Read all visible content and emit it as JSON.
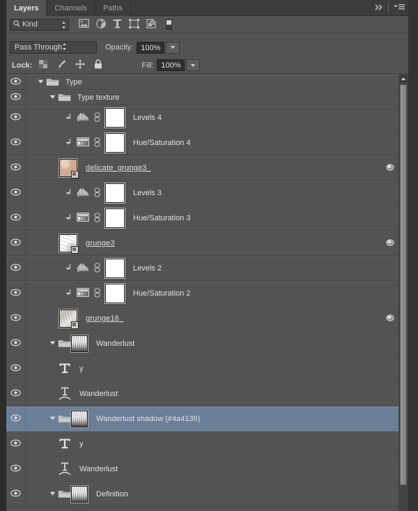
{
  "panel": {
    "tabs": [
      {
        "label": "Layers",
        "active": true
      },
      {
        "label": "Channels",
        "active": false
      },
      {
        "label": "Paths",
        "active": false
      }
    ],
    "collapse_icon": "double-chevron-right-icon",
    "menu_icon": "panel-menu-icon"
  },
  "filter": {
    "kind_label": "Kind",
    "search_icon": "search-icon",
    "icons": [
      "pixel-layer-filter-icon",
      "adjustment-layer-filter-icon",
      "type-layer-filter-icon",
      "shape-layer-filter-icon",
      "smart-object-filter-icon",
      "filter-toggle-switch"
    ]
  },
  "blend": {
    "mode": "Pass Through",
    "opacity_label": "Opacity:",
    "opacity_value": "100%"
  },
  "lock": {
    "label": "Lock:",
    "icons": [
      "lock-transparent-pixels-icon",
      "lock-image-pixels-icon",
      "lock-position-icon",
      "lock-all-icon"
    ],
    "fill_label": "Fill:",
    "fill_value": "100%"
  },
  "layers": [
    {
      "name": "Type",
      "type": "group",
      "indent": 1,
      "expanded": true,
      "visible": true,
      "selected": false
    },
    {
      "name": "Type texture",
      "type": "group",
      "indent": 2,
      "expanded": true,
      "visible": true,
      "selected": false
    },
    {
      "name": "Levels 4",
      "type": "adjustment",
      "adj_icon": "levels-icon",
      "clipped": true,
      "linked": true,
      "indent": 3,
      "visible": true,
      "selected": false
    },
    {
      "name": "Hue/Saturation 4",
      "type": "adjustment",
      "adj_icon": "hue-saturation-icon",
      "clipped": true,
      "linked": true,
      "indent": 3,
      "visible": true,
      "selected": false
    },
    {
      "name": "delicate_grunge3_",
      "type": "smartobject",
      "indent": 3,
      "visible": true,
      "selected": false,
      "has_fx": true,
      "thumb": "texture-beige"
    },
    {
      "name": "Levels 3",
      "type": "adjustment",
      "adj_icon": "levels-icon",
      "clipped": true,
      "linked": true,
      "indent": 3,
      "visible": true,
      "selected": false
    },
    {
      "name": "Hue/Saturation 3",
      "type": "adjustment",
      "adj_icon": "hue-saturation-icon",
      "clipped": true,
      "linked": true,
      "indent": 3,
      "visible": true,
      "selected": false
    },
    {
      "name": "grunge3",
      "type": "smartobject",
      "indent": 3,
      "visible": true,
      "selected": false,
      "has_fx": true,
      "thumb": "texture-light"
    },
    {
      "name": "Levels 2",
      "type": "adjustment",
      "adj_icon": "levels-icon",
      "clipped": true,
      "linked": true,
      "indent": 3,
      "visible": true,
      "selected": false
    },
    {
      "name": "Hue/Saturation 2",
      "type": "adjustment",
      "adj_icon": "hue-saturation-icon",
      "clipped": true,
      "linked": true,
      "indent": 3,
      "visible": true,
      "selected": false
    },
    {
      "name": "grunge16_",
      "type": "smartobject",
      "indent": 3,
      "visible": true,
      "selected": false,
      "has_fx": true,
      "thumb": "texture-grey"
    },
    {
      "name": "Wanderlust",
      "type": "group-thumb",
      "indent": 2,
      "expanded": true,
      "visible": true,
      "selected": false,
      "thumb": "texture-dark"
    },
    {
      "name": "y",
      "type": "type",
      "indent": 3,
      "visible": true,
      "selected": false
    },
    {
      "name": "Wanderlust",
      "type": "warped-type",
      "indent": 3,
      "visible": true,
      "selected": false
    },
    {
      "name": "Wanderlust shadow (#4a4136)",
      "type": "group-thumb",
      "indent": 2,
      "expanded": true,
      "visible": true,
      "selected": true,
      "thumb": "texture-dark"
    },
    {
      "name": "y",
      "type": "type",
      "indent": 3,
      "visible": true,
      "selected": false
    },
    {
      "name": "Wanderlust",
      "type": "warped-type",
      "indent": 3,
      "visible": true,
      "selected": false
    },
    {
      "name": "Definition",
      "type": "group-thumb",
      "indent": 2,
      "expanded": true,
      "visible": true,
      "selected": false,
      "thumb": "texture-dark"
    }
  ],
  "colors": {
    "panel_bg": "#535353",
    "chrome_bg": "#3c3c3c",
    "selection": "#6b7f99",
    "text": "#e0e0e0",
    "outer": "#2b2b2b"
  }
}
